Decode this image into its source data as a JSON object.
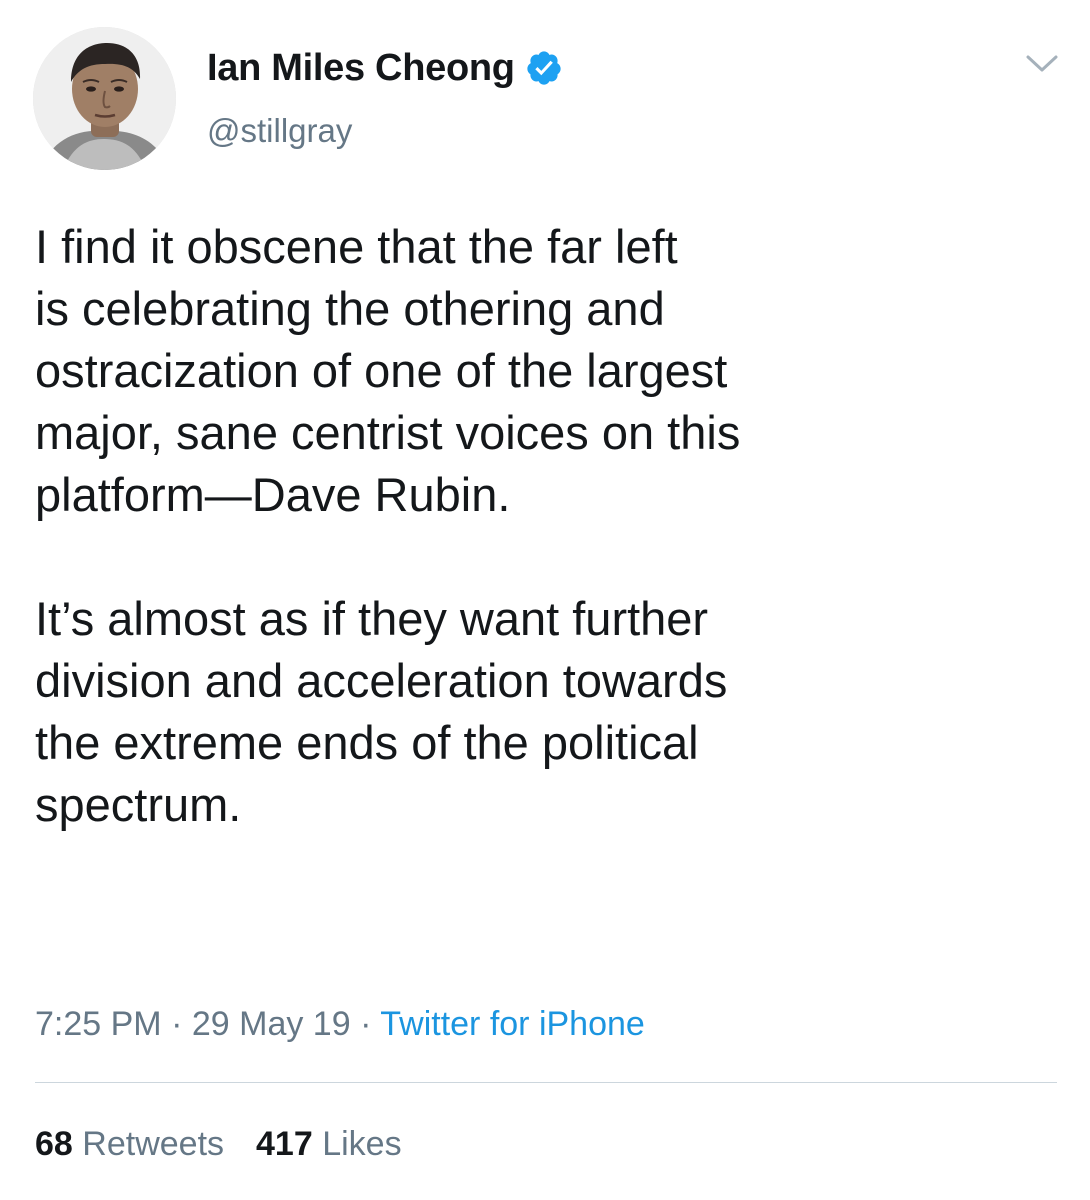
{
  "author": {
    "display_name": "Ian Miles Cheong",
    "handle": "@stillgray",
    "avatar_icon": "profile-photo",
    "verified_icon": "verified-badge-icon",
    "verified_color": "#1da1f2"
  },
  "header": {
    "more_icon": "chevron-down-icon"
  },
  "tweet": {
    "paragraphs": [
      "I find it obscene that the far left\nis celebrating the othering and\nostracization of one of the largest\nmajor, sane centrist voices on this\nplatform—Dave Rubin.",
      "It’s almost as if they want further\ndivision and acceleration towards\nthe extreme ends of the political\nspectrum."
    ],
    "time": "7:25 PM",
    "date": "29 May 19",
    "separator": "·",
    "source": "Twitter for iPhone"
  },
  "stats": {
    "retweets_count": "68",
    "retweets_label": "Retweets",
    "likes_count": "417",
    "likes_label": "Likes"
  },
  "colors": {
    "text": "#14171a",
    "secondary_text": "#657786",
    "link": "#1b95e0",
    "divider": "#ccd6dd"
  }
}
